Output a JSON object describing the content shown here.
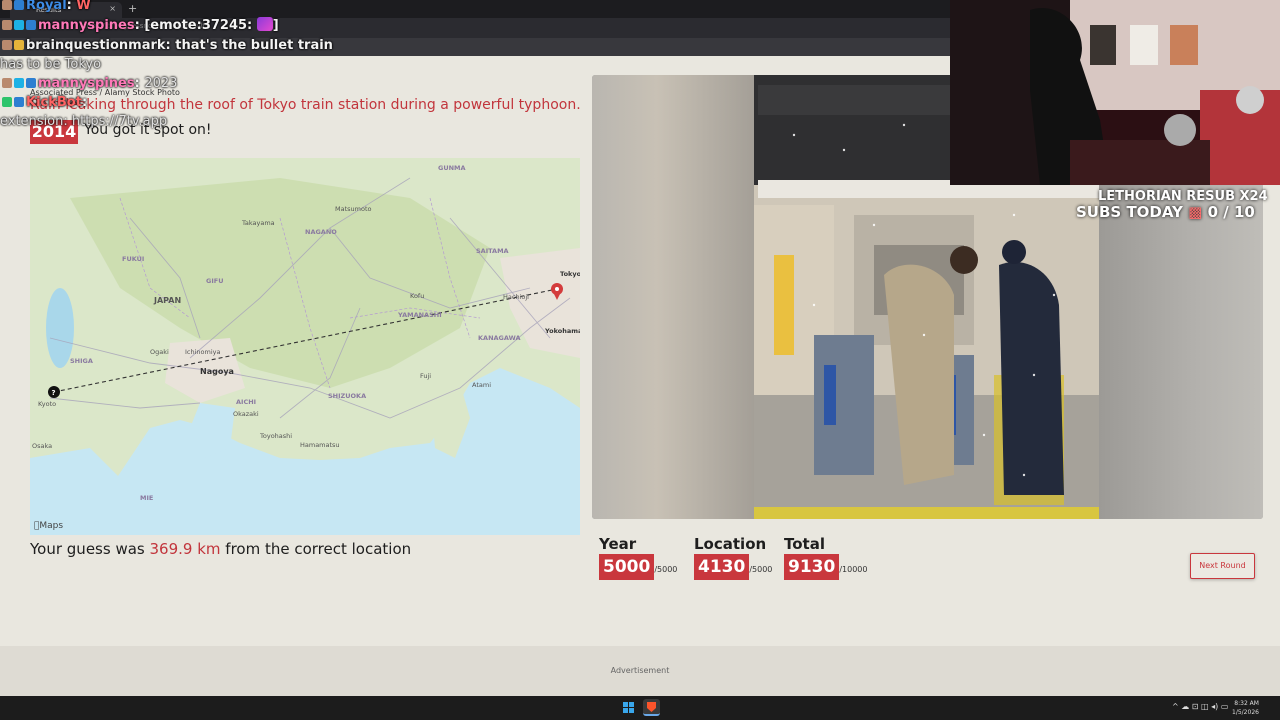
{
  "browser": {
    "tab_title": "Results",
    "tab_close": "×",
    "new_tab": "+",
    "url": "https://timeguessr.com/roundresults"
  },
  "chat": [
    {
      "user": "Royal",
      "text": "W"
    },
    {
      "user": "mannyspines",
      "text": "[emote:37245:",
      "suffix": "]"
    },
    {
      "user": "brainquestionmark",
      "text": "that's the bullet train"
    },
    {
      "user": "",
      "text": "has to be Tokyo"
    },
    {
      "user": "mannyspines",
      "text": "2023"
    },
    {
      "user": "KickBot",
      "text": ""
    },
    {
      "user": "",
      "text": "extension: https://7tv.app"
    }
  ],
  "photo": {
    "credit": "Associated Press / Alamy Stock Photo",
    "caption": "Rain leaking through the roof of Tokyo train station during a powerful typhoon.",
    "year": "2014",
    "year_feedback": "You got it spot on!"
  },
  "map": {
    "guess_marker_icon": "guess-pin-icon",
    "correct_marker_icon": "correct-pin-icon",
    "labels": {
      "japan": "JAPAN",
      "nagoya": "Nagoya",
      "gunma": "GUNMA",
      "saitama": "SAITAMA",
      "nagano": "NAGANO",
      "fukui": "FUKUI",
      "gifu": "GIFU",
      "yamanashi": "YAMANASHI",
      "kanagawa": "KANAGAWA",
      "shizuoka": "SHIZUOKA",
      "aichi": "AICHI",
      "shiga": "SHIGA",
      "mie": "MIE",
      "tokyo": "Tokyo",
      "yokohama": "Yokohama",
      "hachioji": "Hachioji",
      "matsumoto": "Matsumoto",
      "takayama": "Takayama",
      "hamamatsu": "Hamamatsu",
      "toyohashi": "Toyohashi",
      "okazaki": "Okazaki",
      "fuji": "Fuji",
      "atami": "Atami",
      "ichinomiya": "Ichinomiya",
      "ogaki": "Ogaki",
      "kofu": "Kofu",
      "osaka": "Osaka",
      "kyoto": "Kyoto",
      "maps": "Maps"
    }
  },
  "result": {
    "prefix": "Your guess was ",
    "distance": "369.9 km",
    "suffix": " from the correct location"
  },
  "scores": {
    "year": {
      "label": "Year",
      "value": "5000",
      "max": "/5000"
    },
    "location": {
      "label": "Location",
      "value": "4130",
      "max": "/5000"
    },
    "total": {
      "label": "Total",
      "value": "9130",
      "max": "/10000"
    }
  },
  "next_button": "Next Round",
  "advertisement": "Advertisement",
  "overlay": {
    "resub": "LETHORIAN RESUB X24",
    "subs_today": "SUBS TODAY",
    "subs_count": "0 / 10"
  },
  "taskbar": {
    "tray_icons": "^ ☁ ⊡ ◫ ◂) ▭",
    "time": "8:32 AM",
    "date": "1/5/2026"
  },
  "colors": {
    "accent": "#c9373d",
    "background": "#e9e7df"
  }
}
